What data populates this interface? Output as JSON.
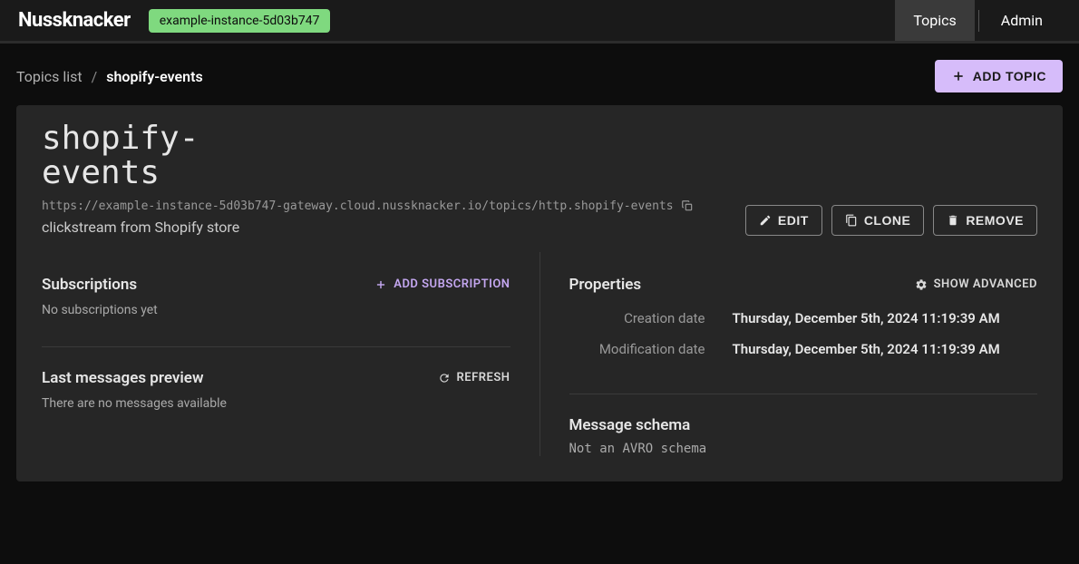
{
  "header": {
    "logo": "Nussknacker",
    "instance": "example-instance-5d03b747",
    "nav": {
      "topics": "Topics",
      "admin": "Admin"
    }
  },
  "breadcrumb": {
    "root": "Topics list",
    "current": "shopify-events"
  },
  "add_topic_btn": "ADD TOPIC",
  "topic": {
    "name": "shopify-events",
    "url": "https://example-instance-5d03b747-gateway.cloud.nussknacker.io/topics/http.shopify-events",
    "description": "clickstream from Shopify store",
    "actions": {
      "edit": "EDIT",
      "clone": "CLONE",
      "remove": "REMOVE"
    }
  },
  "subscriptions": {
    "title": "Subscriptions",
    "add_label": "ADD SUBSCRIPTION",
    "empty": "No subscriptions yet"
  },
  "last_messages": {
    "title": "Last messages preview",
    "refresh_label": "REFRESH",
    "empty": "There are no messages available"
  },
  "properties": {
    "title": "Properties",
    "show_advanced": "SHOW ADVANCED",
    "rows": {
      "creation_label": "Creation date",
      "creation_value": "Thursday, December 5th, 2024 11:19:39 AM",
      "modification_label": "Modification date",
      "modification_value": "Thursday, December 5th, 2024 11:19:39 AM"
    }
  },
  "schema": {
    "title": "Message schema",
    "value": "Not an AVRO schema"
  }
}
